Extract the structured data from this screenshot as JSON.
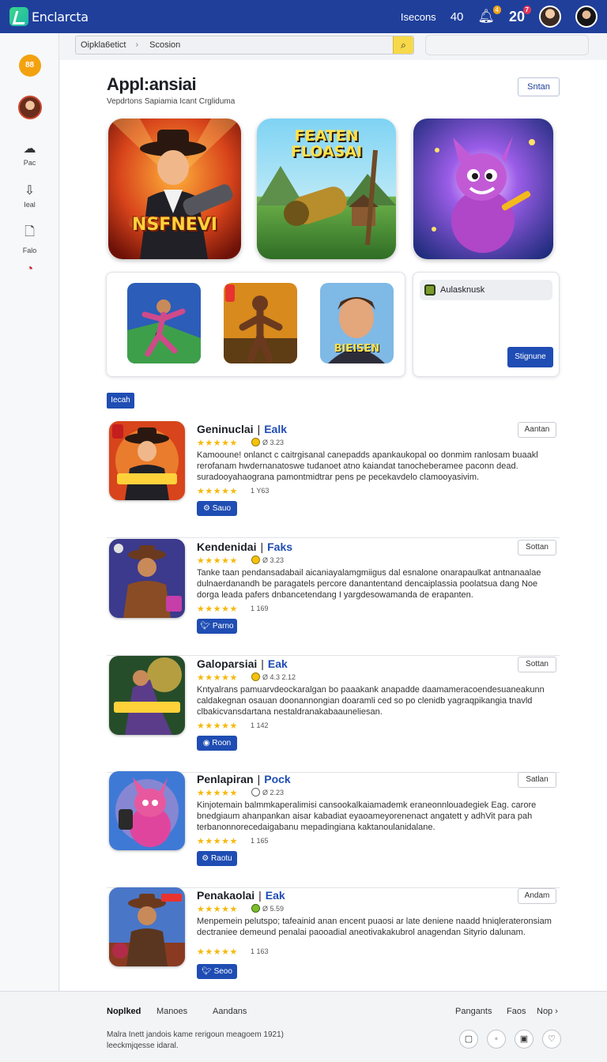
{
  "topbar": {
    "logo_text": "Enclarcta",
    "link_label": "Isecons",
    "count_label": "40",
    "notif_badge": "4",
    "big_number": "20",
    "big_number_badge": "7"
  },
  "sidebar": {
    "badge": "88",
    "items": [
      {
        "label": "Pac",
        "icon": "cloud-icon"
      },
      {
        "label": "Ieal",
        "icon": "download-icon"
      },
      {
        "label": "Falo",
        "icon": "file-icon"
      },
      {
        "label": "",
        "icon": "chart-icon"
      }
    ]
  },
  "search": {
    "breadcrumb": "Oipkla6etict",
    "separator": "›",
    "section": "Scosion"
  },
  "page": {
    "title": "Appl:ansiai",
    "subtitle": "Vepdrtons Sapiamia Icant Crgliduma",
    "sign_button": "Sntan"
  },
  "features": [
    {
      "label": "NSFNEVI",
      "theme": "cowboy"
    },
    {
      "label": "FEATEN FLOASAI",
      "theme": "adventure"
    },
    {
      "label": "",
      "theme": "creature"
    }
  ],
  "mini_thumbs": [
    {
      "label": "",
      "theme": "runner"
    },
    {
      "label": "",
      "theme": "warrior"
    },
    {
      "label": "BIEISEN",
      "theme": "portrait"
    }
  ],
  "side_card": {
    "field_label": "Aulasknusk",
    "button_label": "Stignune"
  },
  "tag_label": "Iecah",
  "list": [
    {
      "title": "Geninuclai",
      "category": "Ealk",
      "button": "Aantan",
      "stars": "★★★★★",
      "meta": "Ø 3.23",
      "desc": "Kamooune! onlanct c caitrgisanal canepadds apankaukopal oo donmim ranlosam buaakl rerofanam hwdernanatoswe tudanoet atno kaiandat tanocheberamee paconn dead. suradooyahaograna pamontmidtrar pens pe pecekavdelo clamooyasivim.",
      "rating_count": "1 Y63",
      "action": "Sauo",
      "action_icon": "gear-icon"
    },
    {
      "title": "Kendenidai",
      "category": "Faks",
      "button": "Sottan",
      "stars": "★★★★★",
      "meta": "Ø 3.23",
      "desc": "Tanke taan pendansadabail aicaniayalamgmiigus dal esnalone onarapaulkat antnanaalae dulnaerdanandh be paragatels percore danantentand dencaiplassia poolatsua dang Noe dorga leada pafers dnbancetendang I yargdesowamanda de erapanten.",
      "rating_count": "1 169",
      "action": "Parno",
      "action_icon": "bird-icon"
    },
    {
      "title": "Galoparsiai",
      "category": "Eak",
      "button": "Sottan",
      "stars": "★★★★★",
      "meta": "Ø 4.3 2.12",
      "desc": "Kntyalrans pamuarvdeockaralgan bo paaakank anapadde daamameracoendesuaneakunn caldakegnan osauan doonannongian doaramli ced so po clenidb yagraqpikangia tnavld clbakicvansdartana nestaldranakabaauneliesan.",
      "rating_count": "1 142",
      "action": "Roon",
      "action_icon": "globe-icon"
    },
    {
      "title": "Penlapiran",
      "category": "Pock",
      "button": "Satlan",
      "stars": "★★★★★",
      "meta": "Ø 2.23",
      "desc": "Kinjotemain balmmkaperalimisi cansookalkaiamademk eraneonnlouadegiek Eag. carore bnedgiaum ahanpankan aisar kabadiat eyaoameyorenenact angatett y adhVit para pah terbanonnorecedaigabanu mepadingiana kaktanoulanidalane.",
      "rating_count": "1 165",
      "action": "Raotu",
      "action_icon": "gear-icon"
    },
    {
      "title": "Penakaolai",
      "category": "Eak",
      "button": "Andam",
      "stars": "★★★★★",
      "meta": "Ø 5.59",
      "desc": "Menpemein pelutspo; tafeainid anan encent puaosi ar late deniene naadd hniqlerateronsiam dectraniee demeund penalai paooadial aneotivakakubrol anagendan Sityrio dalunam.",
      "rating_count": "1 163",
      "action": "Seoo",
      "action_icon": "bird-icon"
    }
  ],
  "footer": {
    "links": [
      "Noplked",
      "Manoes",
      "Aandans"
    ],
    "right_links": [
      "Pangants",
      "Faos",
      "Nop ›"
    ],
    "note": "Malra Inett jandois kame rerigoun meagoem 1921) leeckmjqesse idaral.",
    "circles": [
      "▢",
      "◦",
      "▣",
      "♡"
    ]
  }
}
